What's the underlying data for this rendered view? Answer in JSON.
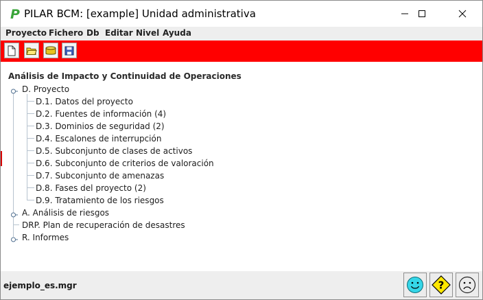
{
  "window": {
    "title": "PILAR BCM: [example] Unidad administrativa",
    "logo_letter": "P",
    "controls": [
      "minimize-icon",
      "maximize-icon",
      "close-icon"
    ]
  },
  "menubar": {
    "items": [
      "Proyecto",
      "Fichero",
      "Db",
      "Editar",
      "Nivel",
      "Ayuda"
    ]
  },
  "toolbar": {
    "background": "#ff0000",
    "buttons": [
      "new-file-icon",
      "open-folder-icon",
      "database-icon",
      "save-icon"
    ]
  },
  "tree": {
    "root": "Análisis de Impacto y Continuidad de Operaciones",
    "nodes": {
      "proyecto": "D. Proyecto",
      "children": [
        "D.1. Datos del proyecto",
        "D.2. Fuentes de información (4)",
        "D.3. Dominios de seguridad (2)",
        "D.4. Escalones de interrupción",
        "D.5. Subconjunto de clases de activos",
        "D.6. Subconjunto de criterios de valoración",
        "D.7. Subconjunto de amenazas",
        "D.8. Fases del proyecto (2)",
        "D.9. Tratamiento de los riesgos"
      ],
      "analisis": "A. Análisis de riesgos",
      "drp": "DRP. Plan de recuperación de desastres",
      "informes": "R. Informes"
    }
  },
  "status": {
    "filename": "ejemplo_es.mgr",
    "buttons": [
      "happy-face-icon",
      "help-question-icon",
      "sad-face-icon"
    ]
  },
  "colors": {
    "toolbar_accent": "#ff0000",
    "logo": "#e7a400",
    "tree_lines": "#b7c3cf"
  }
}
